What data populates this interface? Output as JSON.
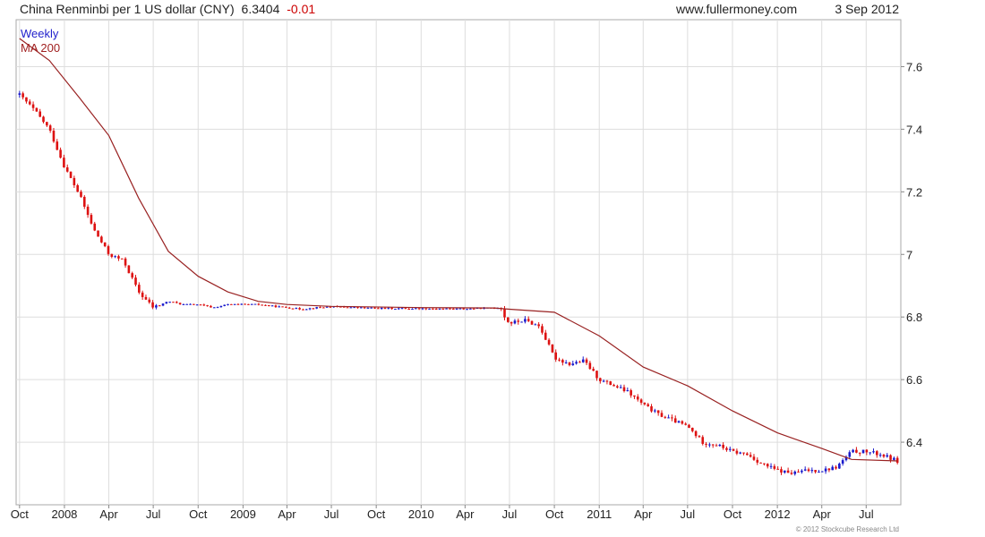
{
  "header": {
    "title": "China Renminbi per 1 US dollar (CNY)",
    "last_price": "6.3404",
    "change": "-0.01",
    "site": "www.fullermoney.com",
    "date": "3 Sep 2012"
  },
  "legend": {
    "weekly": "Weekly",
    "ma": "MA 200"
  },
  "copyright": "© 2012 Stockcube Research Ltd",
  "colors": {
    "up_candle": "#1a1acc",
    "down_candle": "#dd1111",
    "ma_line": "#992222",
    "grid": "#dddddd",
    "frame": "#aaaaaa"
  },
  "chart_data": {
    "type": "line",
    "title": "China Renminbi per 1 US dollar (CNY)",
    "xlabel": "",
    "ylabel": "",
    "grid": true,
    "legend_position": "top-left",
    "ylim": [
      6.2,
      7.75
    ],
    "y_ticks": [
      6.4,
      6.6,
      6.8,
      7,
      7.2,
      7.4,
      7.6
    ],
    "y_tick_labels": [
      "6.4",
      "6.6",
      "6.8",
      "7",
      "7.2",
      "7.4",
      "7.6"
    ],
    "x_ticks": [
      {
        "date": "2007-10-01",
        "label": "Oct"
      },
      {
        "date": "2008-01-01",
        "label": "2008"
      },
      {
        "date": "2008-04-01",
        "label": "Apr"
      },
      {
        "date": "2008-07-01",
        "label": "Jul"
      },
      {
        "date": "2008-10-01",
        "label": "Oct"
      },
      {
        "date": "2009-01-01",
        "label": "2009"
      },
      {
        "date": "2009-04-01",
        "label": "Apr"
      },
      {
        "date": "2009-07-01",
        "label": "Jul"
      },
      {
        "date": "2009-10-01",
        "label": "Oct"
      },
      {
        "date": "2010-01-01",
        "label": "2010"
      },
      {
        "date": "2010-04-01",
        "label": "Apr"
      },
      {
        "date": "2010-07-01",
        "label": "Jul"
      },
      {
        "date": "2010-10-01",
        "label": "Oct"
      },
      {
        "date": "2011-01-01",
        "label": "2011"
      },
      {
        "date": "2011-04-01",
        "label": "Apr"
      },
      {
        "date": "2011-07-01",
        "label": "Jul"
      },
      {
        "date": "2011-10-01",
        "label": "Oct"
      },
      {
        "date": "2012-01-01",
        "label": "2012"
      },
      {
        "date": "2012-04-01",
        "label": "Apr"
      },
      {
        "date": "2012-07-01",
        "label": "Jul"
      }
    ],
    "xlim": [
      "2007-09-24",
      "2012-09-10"
    ],
    "series": [
      {
        "name": "Weekly",
        "style": "candlestick",
        "points": [
          [
            "2007-10-01",
            7.51
          ],
          [
            "2007-11-01",
            7.46
          ],
          [
            "2007-12-01",
            7.4
          ],
          [
            "2008-01-01",
            7.28
          ],
          [
            "2008-02-01",
            7.19
          ],
          [
            "2008-03-01",
            7.08
          ],
          [
            "2008-04-01",
            7.0
          ],
          [
            "2008-05-01",
            6.98
          ],
          [
            "2008-06-01",
            6.88
          ],
          [
            "2008-07-01",
            6.83
          ],
          [
            "2008-08-01",
            6.85
          ],
          [
            "2008-09-01",
            6.84
          ],
          [
            "2008-10-01",
            6.84
          ],
          [
            "2008-11-01",
            6.83
          ],
          [
            "2008-12-01",
            6.84
          ],
          [
            "2009-01-01",
            6.84
          ],
          [
            "2009-02-01",
            6.84
          ],
          [
            "2009-03-01",
            6.835
          ],
          [
            "2009-04-01",
            6.83
          ],
          [
            "2009-05-01",
            6.825
          ],
          [
            "2009-06-01",
            6.83
          ],
          [
            "2009-07-01",
            6.833
          ],
          [
            "2009-10-01",
            6.828
          ],
          [
            "2010-01-01",
            6.827
          ],
          [
            "2010-04-01",
            6.826
          ],
          [
            "2010-06-14",
            6.83
          ],
          [
            "2010-06-21",
            6.8
          ],
          [
            "2010-07-01",
            6.78
          ],
          [
            "2010-08-01",
            6.79
          ],
          [
            "2010-09-01",
            6.77
          ],
          [
            "2010-10-01",
            6.67
          ],
          [
            "2010-11-01",
            6.65
          ],
          [
            "2010-12-01",
            6.66
          ],
          [
            "2011-01-01",
            6.6
          ],
          [
            "2011-02-01",
            6.58
          ],
          [
            "2011-03-01",
            6.56
          ],
          [
            "2011-04-01",
            6.52
          ],
          [
            "2011-05-01",
            6.49
          ],
          [
            "2011-06-01",
            6.47
          ],
          [
            "2011-07-01",
            6.45
          ],
          [
            "2011-08-01",
            6.4
          ],
          [
            "2011-09-01",
            6.39
          ],
          [
            "2011-10-01",
            6.37
          ],
          [
            "2011-11-01",
            6.36
          ],
          [
            "2011-12-01",
            6.33
          ],
          [
            "2012-01-01",
            6.31
          ],
          [
            "2012-02-01",
            6.3
          ],
          [
            "2012-03-01",
            6.31
          ],
          [
            "2012-04-01",
            6.31
          ],
          [
            "2012-05-01",
            6.32
          ],
          [
            "2012-06-01",
            6.37
          ],
          [
            "2012-07-01",
            6.37
          ],
          [
            "2012-08-01",
            6.36
          ],
          [
            "2012-09-03",
            6.34
          ]
        ]
      },
      {
        "name": "MA 200",
        "style": "line",
        "points": [
          [
            "2007-10-01",
            7.69
          ],
          [
            "2007-12-01",
            7.62
          ],
          [
            "2008-02-01",
            7.5
          ],
          [
            "2008-04-01",
            7.38
          ],
          [
            "2008-06-01",
            7.18
          ],
          [
            "2008-08-01",
            7.01
          ],
          [
            "2008-10-01",
            6.93
          ],
          [
            "2008-12-01",
            6.88
          ],
          [
            "2009-02-01",
            6.85
          ],
          [
            "2009-04-01",
            6.84
          ],
          [
            "2009-07-01",
            6.834
          ],
          [
            "2010-01-01",
            6.83
          ],
          [
            "2010-06-01",
            6.829
          ],
          [
            "2010-07-01",
            6.825
          ],
          [
            "2010-10-01",
            6.815
          ],
          [
            "2011-01-01",
            6.74
          ],
          [
            "2011-04-01",
            6.64
          ],
          [
            "2011-07-01",
            6.58
          ],
          [
            "2011-10-01",
            6.5
          ],
          [
            "2012-01-01",
            6.43
          ],
          [
            "2012-04-01",
            6.38
          ],
          [
            "2012-06-01",
            6.345
          ],
          [
            "2012-09-03",
            6.34
          ]
        ]
      }
    ]
  }
}
